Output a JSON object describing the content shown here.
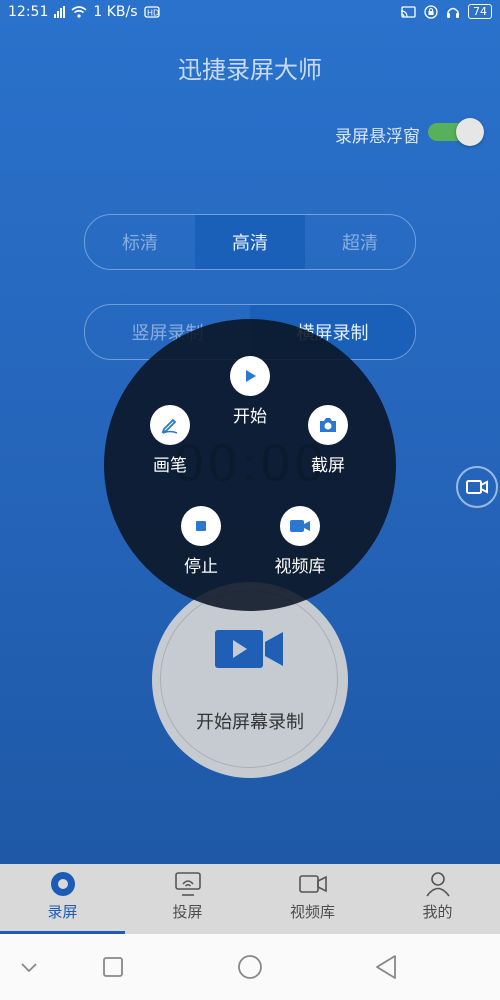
{
  "status_bar": {
    "time": "12:51",
    "speed": "1 KB/s",
    "battery": "74"
  },
  "header": {
    "title": "迅捷录屏大师"
  },
  "float_window": {
    "label": "录屏悬浮窗",
    "enabled": true
  },
  "quality": {
    "options": [
      "标清",
      "高清",
      "超清"
    ],
    "selected": "高清"
  },
  "orientation": {
    "options": [
      "竖屏录制",
      "横屏录制"
    ],
    "selected": "横屏录制"
  },
  "timer": "00:00",
  "record_button": {
    "label": "开始屏幕录制"
  },
  "radial_menu": {
    "start": "开始",
    "pen": "画笔",
    "screenshot": "截屏",
    "stop": "停止",
    "video_library": "视频库"
  },
  "tabs": [
    {
      "label": "录屏",
      "icon": "record-icon",
      "active": true
    },
    {
      "label": "投屏",
      "icon": "cast-icon",
      "active": false
    },
    {
      "label": "视频库",
      "icon": "video-camera-icon",
      "active": false
    },
    {
      "label": "我的",
      "icon": "person-icon",
      "active": false
    }
  ],
  "colors": {
    "accent": "#1c5cb6",
    "toggle_on": "#57b05a",
    "overlay": "#0a1423"
  }
}
